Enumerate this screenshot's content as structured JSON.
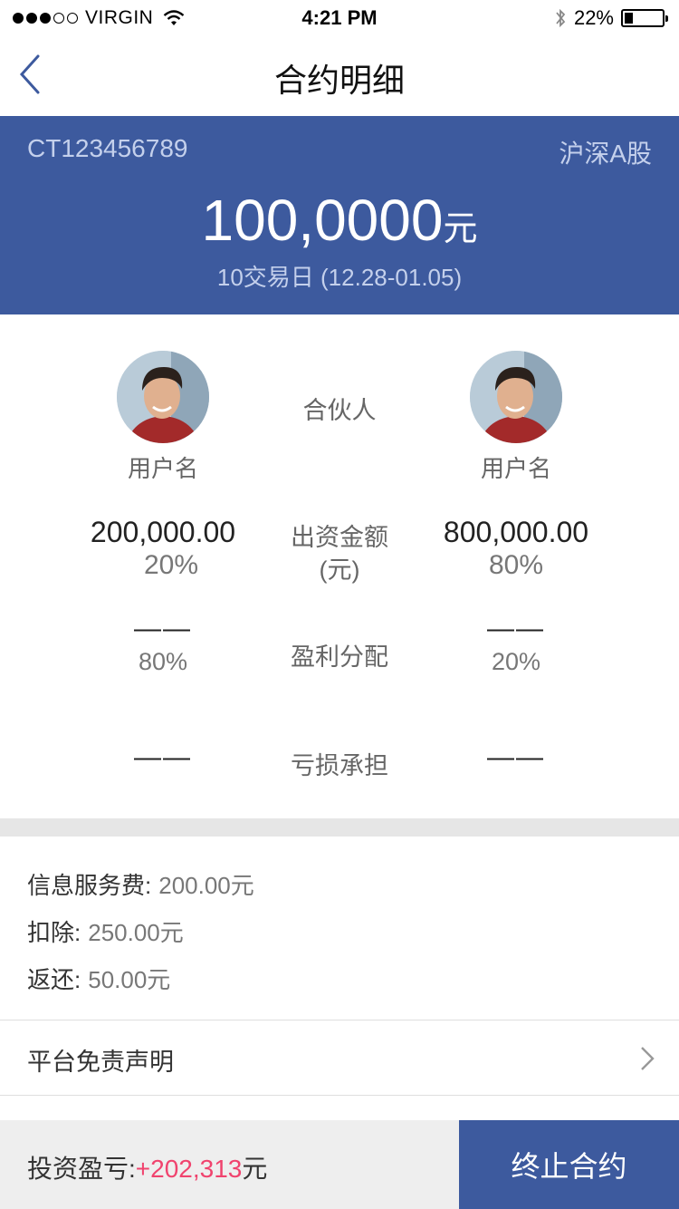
{
  "status_bar": {
    "carrier": "VIRGIN",
    "time": "4:21 PM",
    "battery": "22%",
    "battery_level": 0.22,
    "signal_dots": [
      true,
      true,
      true,
      false,
      false
    ]
  },
  "nav": {
    "title": "合约明细",
    "back_icon": "back-chevron-icon"
  },
  "hero": {
    "contract_id": "CT123456789",
    "market": "沪深A股",
    "amount": "100,0000",
    "unit": "元",
    "period": "10交易日 (12.28-01.05)",
    "background": "#3d5a9e"
  },
  "partners": {
    "center_title": "合伙人",
    "left": {
      "username": "用户名",
      "investment": "200,000.00",
      "investment_pct": "20%",
      "profit_value": "——",
      "profit_pct": "80%",
      "loss": "——"
    },
    "right": {
      "username": "用户名",
      "investment": "800,000.00",
      "investment_pct": "80%",
      "profit_value": "——",
      "profit_pct": "20%",
      "loss": "——"
    },
    "investment_label_line1": "出资金额",
    "investment_label_line2": "(元)",
    "profit_label": "盈利分配",
    "loss_label": "亏损承担"
  },
  "fees": {
    "service_label": "信息服务费:",
    "service_value": "200.00元",
    "deduct_label": "扣除:",
    "deduct_value": "250.00元",
    "refund_label": "返还:",
    "refund_value": "50.00元"
  },
  "disclaimer": {
    "label": "平台免责声明"
  },
  "bottom": {
    "pl_label": "投资盈亏:",
    "pl_value": "+202,313",
    "pl_unit": "元",
    "terminate_label": "终止合约",
    "accent": "#f0436e"
  }
}
